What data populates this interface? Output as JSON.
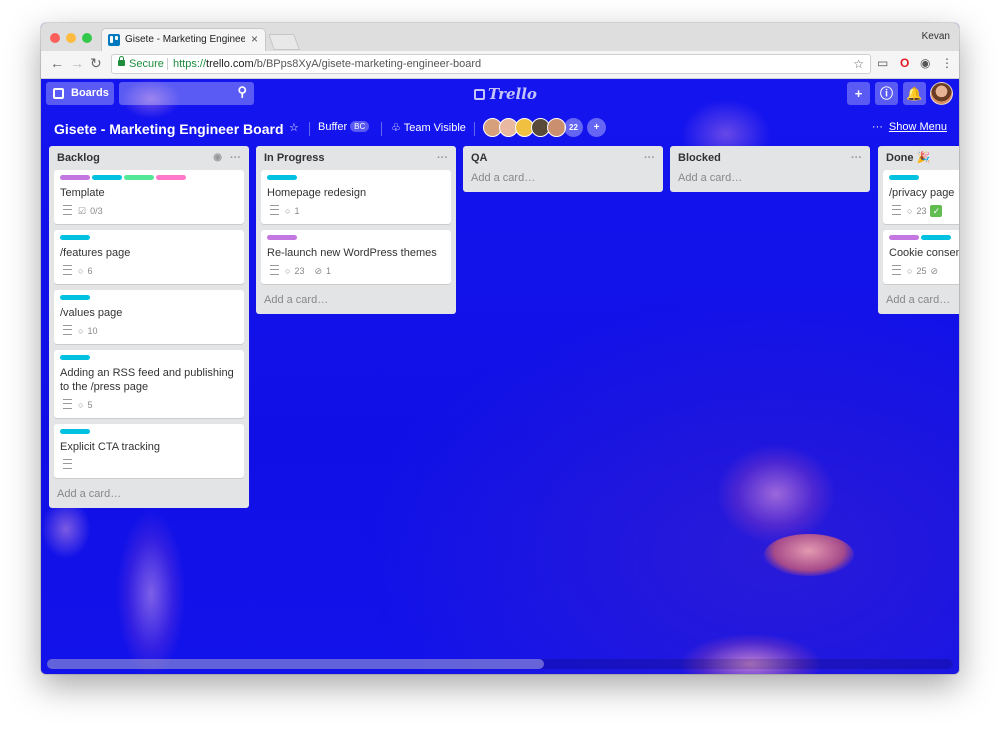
{
  "browser": {
    "tab_title": "Gisete - Marketing Engineer Bo",
    "tab_close": "×",
    "profile_name": "Kevan",
    "secure_label": "Secure",
    "url_scheme": "https://",
    "url_domain": "trello.com",
    "url_path": "/b/BPps8XyA/gisete-marketing-engineer-board"
  },
  "header": {
    "boards_label": "Boards",
    "logo_text": "Trello",
    "board_title": "Gisete - Marketing Engineer Board",
    "team_name": "Buffer",
    "team_badge": "BC",
    "visibility": "Team Visible",
    "member_count": "22",
    "show_menu": "Show Menu",
    "show_menu_dots": "···"
  },
  "colors": {
    "purple": "#c377e0",
    "cyan": "#00c2e0",
    "green": "#51e898",
    "pink": "#ff78cb",
    "background": "#1212ee"
  },
  "lists": [
    {
      "title": "Backlog",
      "cards": [
        {
          "labels": [
            "purple",
            "cyan",
            "green",
            "pink"
          ],
          "text": "Template",
          "checklist": "0/3"
        },
        {
          "labels": [
            "cyan"
          ],
          "text": "/features page",
          "comments": "6"
        },
        {
          "labels": [
            "cyan"
          ],
          "text": "/values page",
          "comments": "10"
        },
        {
          "labels": [
            "cyan"
          ],
          "text": "Adding an RSS feed and publishing to the /press page",
          "comments": "5"
        },
        {
          "labels": [
            "cyan"
          ],
          "text": "Explicit CTA tracking"
        }
      ],
      "add_card": "Add a card…"
    },
    {
      "title": "In Progress",
      "cards": [
        {
          "labels": [
            "cyan"
          ],
          "text": "Homepage redesign",
          "comments": "1"
        },
        {
          "labels": [
            "purple"
          ],
          "text": "Re-launch new WordPress themes",
          "comments": "23",
          "attachments": "1"
        }
      ],
      "add_card": "Add a card…"
    },
    {
      "title": "QA",
      "cards": [],
      "add_card": "Add a card…"
    },
    {
      "title": "Blocked",
      "cards": [],
      "add_card": "Add a card…"
    },
    {
      "title": "Done 🎉",
      "cards": [
        {
          "labels": [
            "cyan"
          ],
          "text": "/privacy page",
          "comments": "23"
        },
        {
          "labels": [
            "purple",
            "cyan"
          ],
          "text": "Cookie consent",
          "comments": "25"
        }
      ],
      "add_card": "Add a card…"
    }
  ]
}
